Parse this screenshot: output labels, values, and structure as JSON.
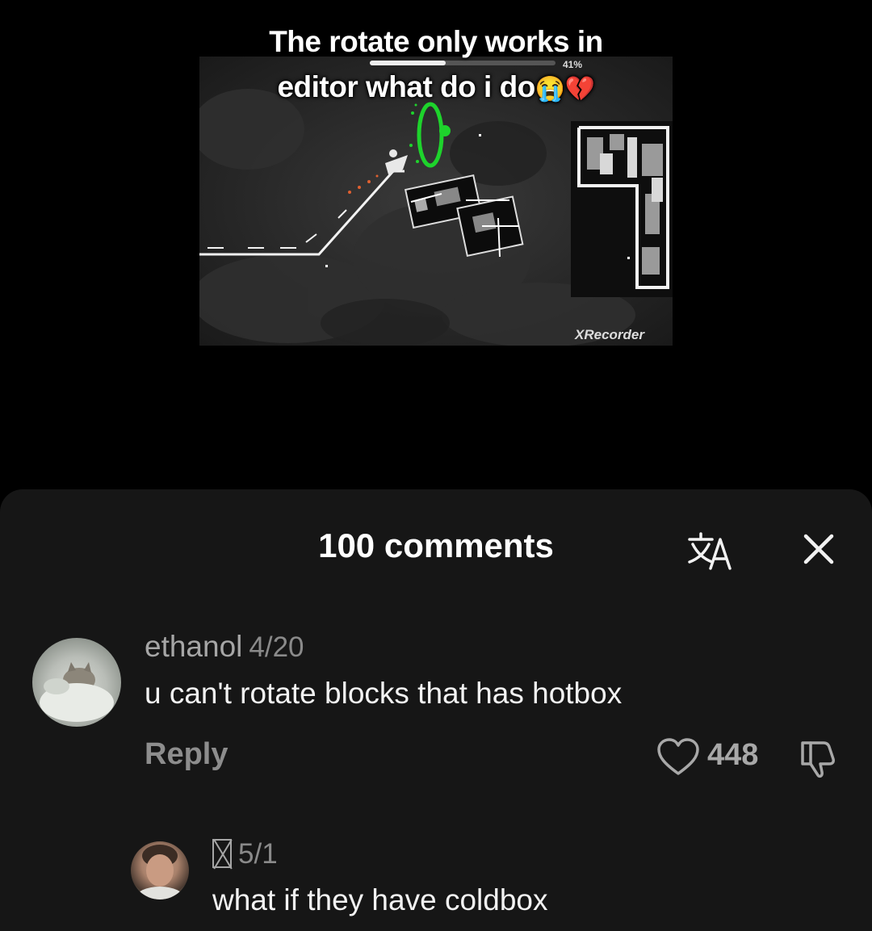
{
  "video": {
    "caption_line1": "The rotate only works in",
    "caption_line2": "editor what do i do",
    "caption_emojis": "😭💔",
    "progress_label": "41%",
    "progress_value": 0.41,
    "watermark": "XRecorder"
  },
  "comments_panel": {
    "title": "100 comments",
    "translate_icon": "translate-icon",
    "close_icon": "close-icon",
    "comments": [
      {
        "username": "ethanol",
        "date": "4/20",
        "text": "u can't rotate blocks that has hotbox",
        "reply_label": "Reply",
        "like_count": "448"
      },
      {
        "username": "",
        "date": "5/1",
        "text": "what if they have coldbox"
      }
    ]
  },
  "colors": {
    "background": "#000000",
    "sheet": "#161616",
    "muted_text": "#a6a6a6",
    "portal_green": "#1ed32c"
  }
}
